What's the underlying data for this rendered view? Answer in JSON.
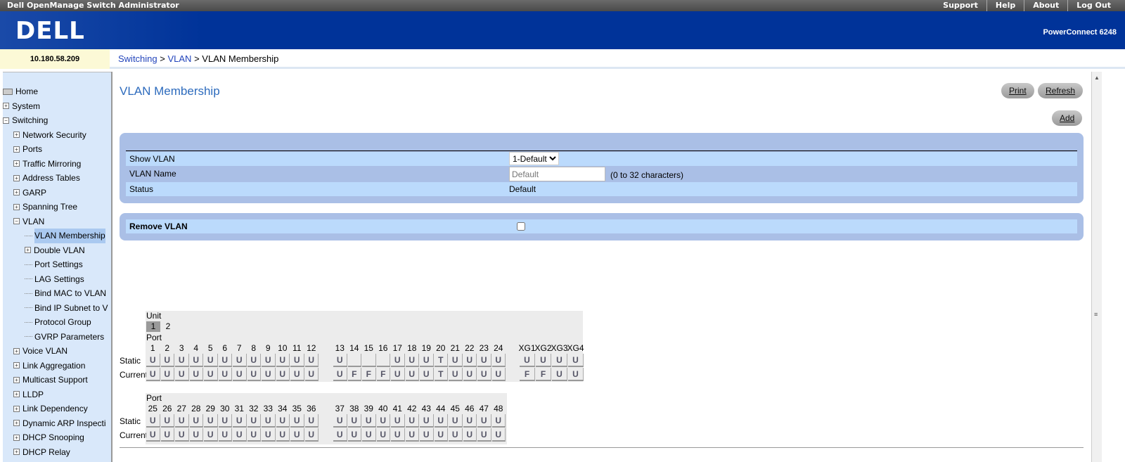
{
  "app_title": "Dell OpenManage Switch Administrator",
  "top_links": [
    "Support",
    "Help",
    "About",
    "Log Out"
  ],
  "logo": "DELL",
  "model": "PowerConnect 6248",
  "ip": "10.180.58.209",
  "breadcrumb": {
    "sep": ">",
    "items": [
      "Switching",
      "VLAN"
    ],
    "current": "VLAN Membership"
  },
  "sidebar": [
    {
      "label": "Home",
      "lvl": 0,
      "icon": "home"
    },
    {
      "label": "System",
      "lvl": 0,
      "icon": "plus"
    },
    {
      "label": "Switching",
      "lvl": 0,
      "icon": "minus"
    },
    {
      "label": "Network Security",
      "lvl": 1,
      "icon": "plus"
    },
    {
      "label": "Ports",
      "lvl": 1,
      "icon": "plus"
    },
    {
      "label": "Traffic Mirroring",
      "lvl": 1,
      "icon": "plus"
    },
    {
      "label": "Address Tables",
      "lvl": 1,
      "icon": "plus"
    },
    {
      "label": "GARP",
      "lvl": 1,
      "icon": "plus"
    },
    {
      "label": "Spanning Tree",
      "lvl": 1,
      "icon": "plus"
    },
    {
      "label": "VLAN",
      "lvl": 1,
      "icon": "minus"
    },
    {
      "label": "VLAN Membership",
      "lvl": 2,
      "icon": "leaf",
      "selected": true
    },
    {
      "label": "Double VLAN",
      "lvl": 2,
      "icon": "plus"
    },
    {
      "label": "Port Settings",
      "lvl": 2,
      "icon": "leaf"
    },
    {
      "label": "LAG Settings",
      "lvl": 2,
      "icon": "leaf"
    },
    {
      "label": "Bind MAC to VLAN",
      "lvl": 2,
      "icon": "leaf"
    },
    {
      "label": "Bind IP Subnet to V",
      "lvl": 2,
      "icon": "leaf"
    },
    {
      "label": "Protocol Group",
      "lvl": 2,
      "icon": "leaf"
    },
    {
      "label": "GVRP Parameters",
      "lvl": 2,
      "icon": "leaf"
    },
    {
      "label": "Voice VLAN",
      "lvl": 1,
      "icon": "plus"
    },
    {
      "label": "Link Aggregation",
      "lvl": 1,
      "icon": "plus"
    },
    {
      "label": "Multicast Support",
      "lvl": 1,
      "icon": "plus"
    },
    {
      "label": "LLDP",
      "lvl": 1,
      "icon": "plus"
    },
    {
      "label": "Link Dependency",
      "lvl": 1,
      "icon": "plus"
    },
    {
      "label": "Dynamic ARP Inspecti",
      "lvl": 1,
      "icon": "plus"
    },
    {
      "label": "DHCP Snooping",
      "lvl": 1,
      "icon": "plus"
    },
    {
      "label": "DHCP Relay",
      "lvl": 1,
      "icon": "plus"
    }
  ],
  "page_title": "VLAN Membership",
  "buttons": {
    "print": "Print",
    "refresh": "Refresh",
    "add": "Add"
  },
  "form": {
    "show_vlan_label": "Show VLAN",
    "show_vlan_value": "1-Default",
    "vlan_name_label": "VLAN Name",
    "vlan_name_placeholder": "Default",
    "vlan_name_hint": "(0 to 32 characters)",
    "status_label": "Status",
    "status_value": "Default",
    "remove_vlan_label": "Remove VLAN",
    "remove_vlan_checked": false
  },
  "ports": {
    "unit_label": "Unit",
    "units": [
      "1",
      "2"
    ],
    "selected_unit": "1",
    "port_label": "Port",
    "static_label": "Static",
    "current_label": "Current",
    "blocks": [
      {
        "groups": [
          {
            "ports": [
              "1",
              "2",
              "3",
              "4",
              "5",
              "6",
              "7",
              "8",
              "9",
              "10",
              "11",
              "12"
            ],
            "static": [
              "U",
              "U",
              "U",
              "U",
              "U",
              "U",
              "U",
              "U",
              "U",
              "U",
              "U",
              "U"
            ],
            "current": [
              "U",
              "U",
              "U",
              "U",
              "U",
              "U",
              "U",
              "U",
              "U",
              "U",
              "U",
              "U"
            ]
          },
          {
            "ports": [
              "13",
              "14",
              "15",
              "16",
              "17",
              "18",
              "19",
              "20",
              "21",
              "22",
              "23",
              "24"
            ],
            "static": [
              "U",
              "",
              "",
              "",
              "U",
              "U",
              "U",
              "T",
              "U",
              "U",
              "U",
              "U"
            ],
            "current": [
              "U",
              "F",
              "F",
              "F",
              "U",
              "U",
              "U",
              "T",
              "U",
              "U",
              "U",
              "U"
            ]
          },
          {
            "ports": [
              "XG1",
              "XG2",
              "XG3",
              "XG4"
            ],
            "static": [
              "U",
              "U",
              "U",
              "U"
            ],
            "current": [
              "F",
              "F",
              "U",
              "U"
            ]
          }
        ]
      },
      {
        "groups": [
          {
            "ports": [
              "25",
              "26",
              "27",
              "28",
              "29",
              "30",
              "31",
              "32",
              "33",
              "34",
              "35",
              "36"
            ],
            "static": [
              "U",
              "U",
              "U",
              "U",
              "U",
              "U",
              "U",
              "U",
              "U",
              "U",
              "U",
              "U"
            ],
            "current": [
              "U",
              "U",
              "U",
              "U",
              "U",
              "U",
              "U",
              "U",
              "U",
              "U",
              "U",
              "U"
            ]
          },
          {
            "ports": [
              "37",
              "38",
              "39",
              "40",
              "41",
              "42",
              "43",
              "44",
              "45",
              "46",
              "47",
              "48"
            ],
            "static": [
              "U",
              "U",
              "U",
              "U",
              "U",
              "U",
              "U",
              "U",
              "U",
              "U",
              "U",
              "U"
            ],
            "current": [
              "U",
              "U",
              "U",
              "U",
              "U",
              "U",
              "U",
              "U",
              "U",
              "U",
              "U",
              "U"
            ]
          }
        ]
      }
    ]
  }
}
